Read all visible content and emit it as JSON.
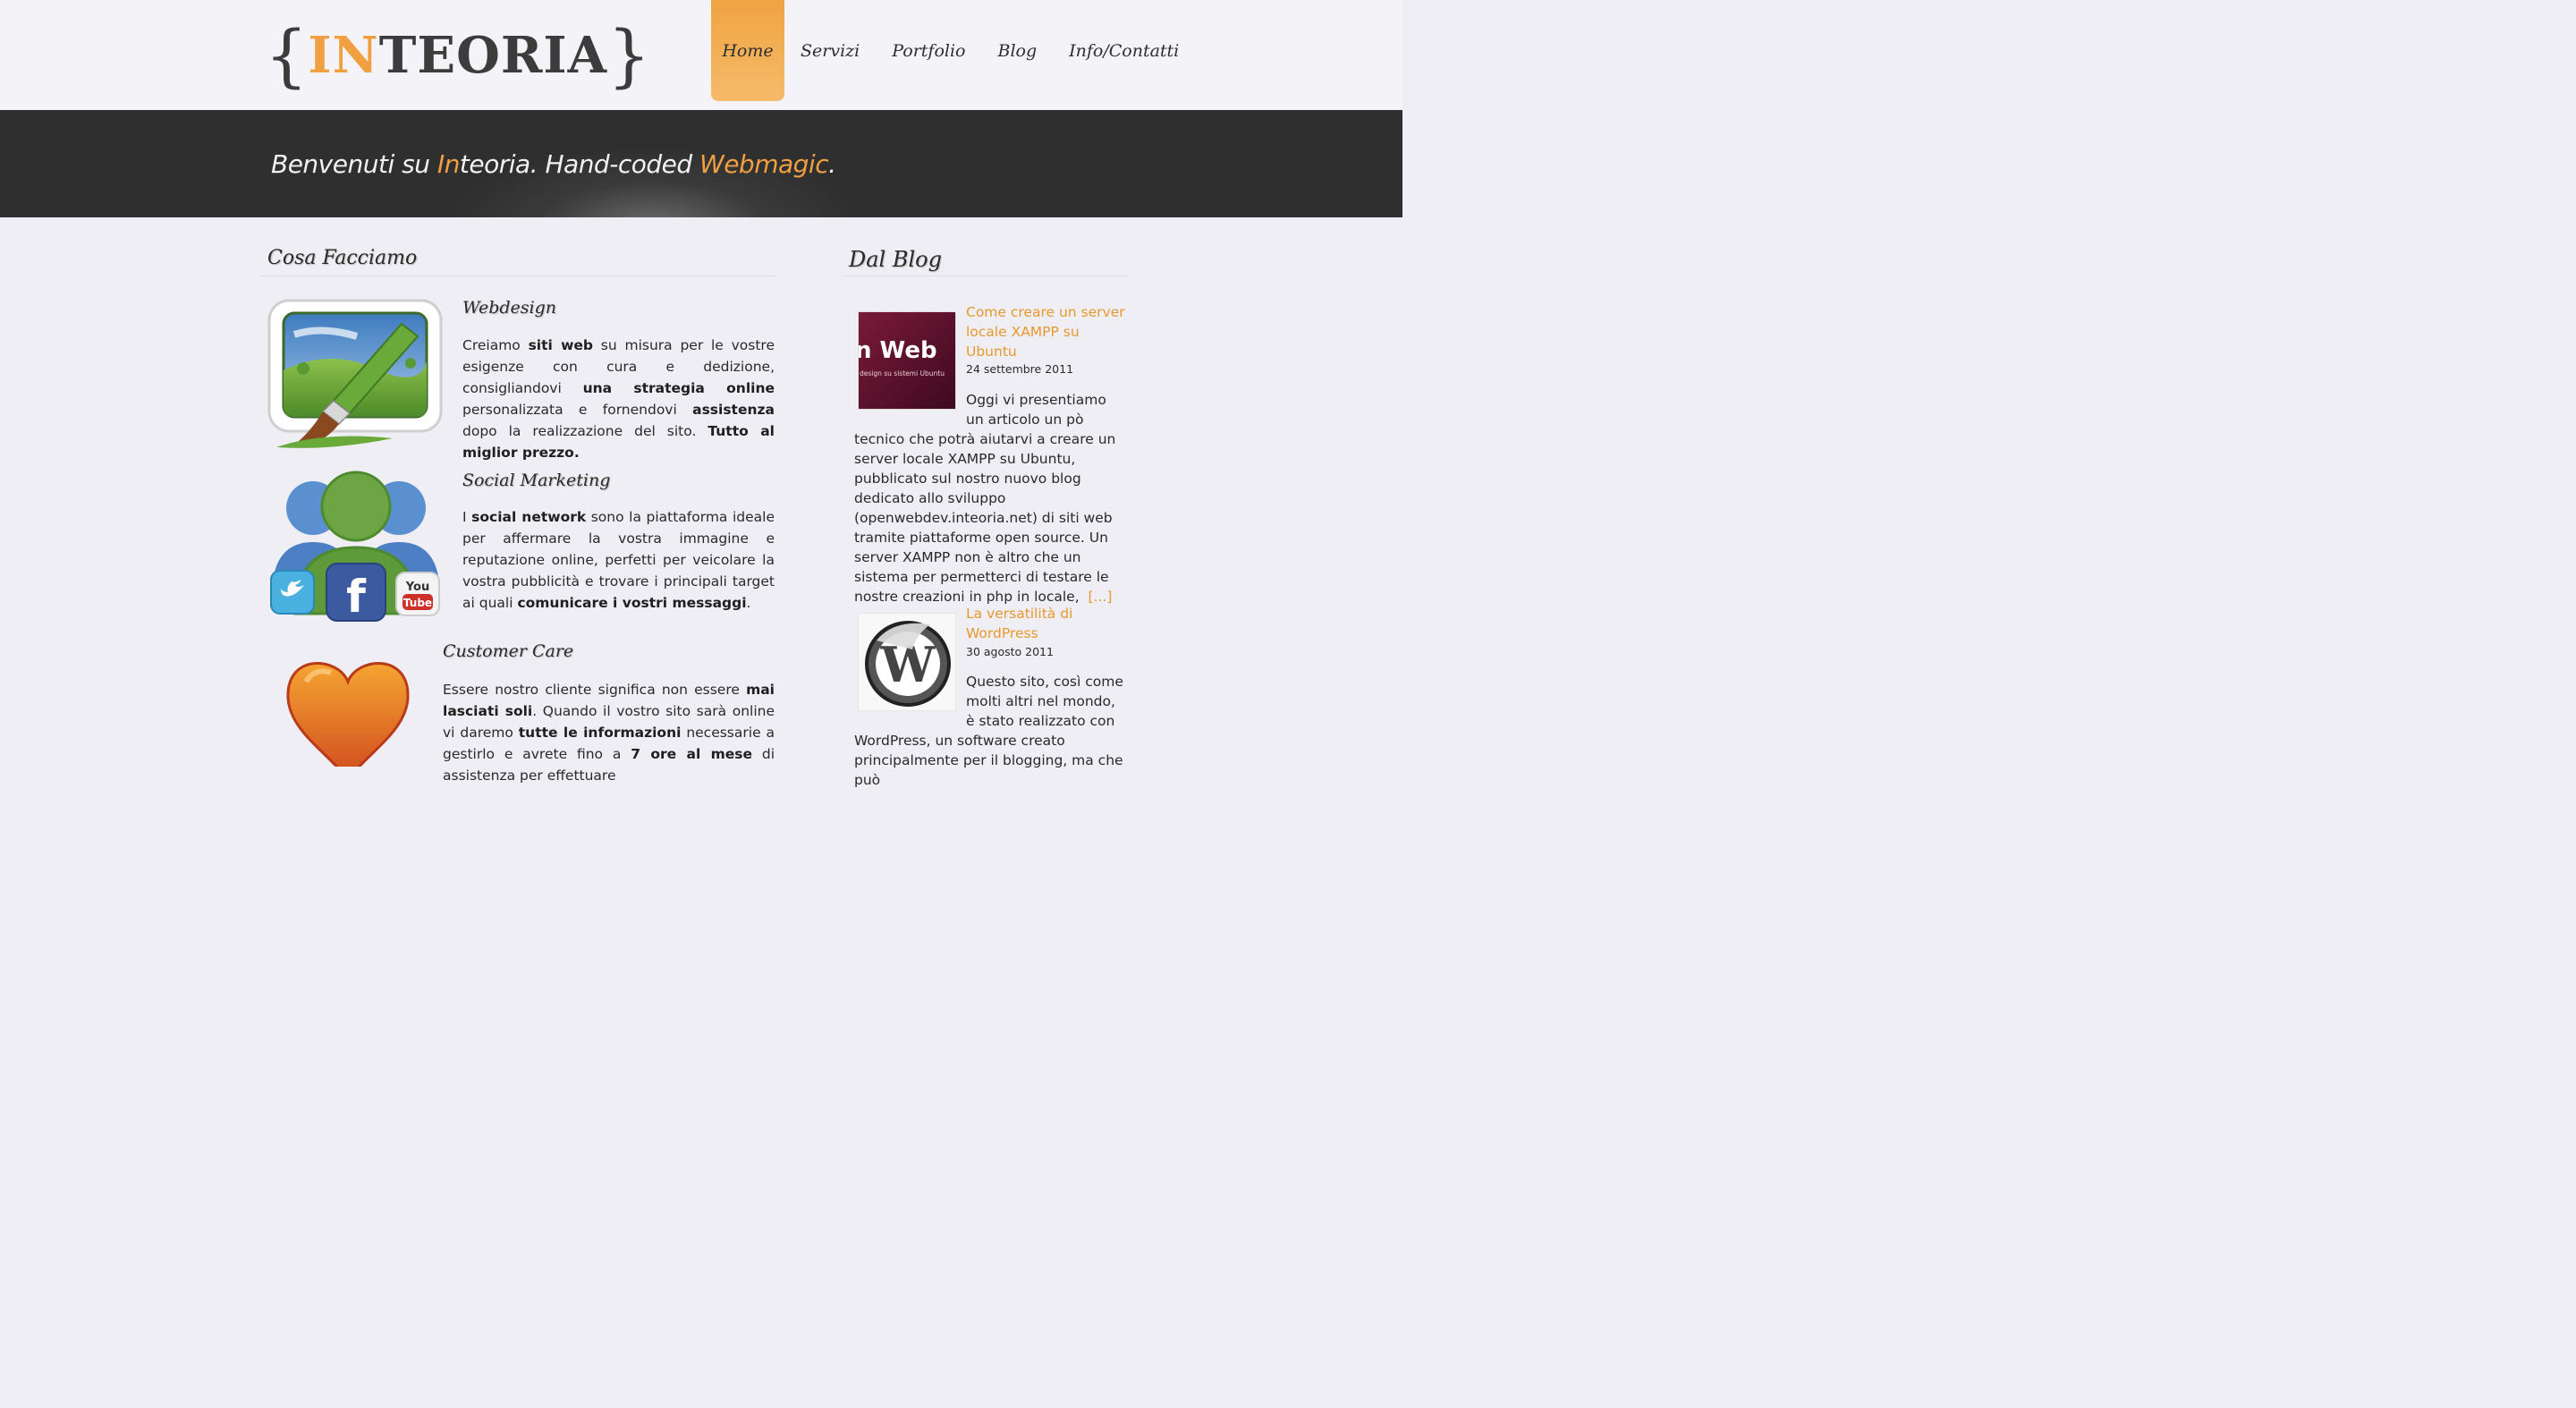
{
  "logo": {
    "brace_open": "{",
    "in": "IN",
    "rest": "TEORIA",
    "brace_close": "}"
  },
  "nav": [
    {
      "label": "Home",
      "active": true
    },
    {
      "label": "Servizi",
      "active": false
    },
    {
      "label": "Portfolio",
      "active": false
    },
    {
      "label": "Blog",
      "active": false
    },
    {
      "label": "Info/Contatti",
      "active": false
    }
  ],
  "banner": {
    "part1": "Benvenuti su ",
    "in": "In",
    "part2": "teoria. Hand-coded ",
    "magic": "Webmagic",
    "dot": "."
  },
  "services": {
    "title": "Cosa Facciamo",
    "items": [
      {
        "title": "Webdesign",
        "text_parts": [
          "Creiamo ",
          "siti web",
          " su misura per le vostre esigenze con cura e dedizione, consigliandovi ",
          "una strategia online",
          " personalizzata e fornendovi ",
          "assistenza",
          " dopo la realizzazione del sito. ",
          "Tutto al miglior prezzo."
        ]
      },
      {
        "title": "Social Marketing",
        "text_parts": [
          "I ",
          "social network",
          " sono la piattaforma ideale per affermare la vostra immagine e reputazione online, perfetti per veicolare la vostra pubblicità e trovare i principali target ai quali ",
          "comunicare i vostri messaggi",
          "."
        ]
      },
      {
        "title": "Customer Care",
        "text_parts": [
          "Essere nostro cliente significa non essere ",
          "mai lasciati soli",
          ". Quando il vostro sito sarà online vi daremo ",
          "tutte le informazioni",
          " necessarie a gestirlo e avrete fino a ",
          "7 ore al mese",
          " di assistenza per effettuare"
        ]
      }
    ]
  },
  "blog": {
    "title": "Dal Blog",
    "posts": [
      {
        "thumb_text": "n Web",
        "thumb_subtext": "design su sistemi Ubuntu",
        "title": "Come creare un server locale XAMPP su Ubuntu",
        "date": "24 settembre 2011",
        "excerpt": "Oggi vi presentiamo un articolo un pò tecnico che potrà aiutarvi a creare un server locale XAMPP su Ubuntu, pubblicato sul nostro nuovo blog dedicato allo sviluppo (openwebdev.inteoria.net) di siti web tramite piattaforme open source. Un server XAMPP non è altro che un sistema per permetterci di testare le nostre creazioni in php in locale,",
        "more": "[...]"
      },
      {
        "title": "La versatilità di WordPress",
        "date": "30 agosto 2011",
        "excerpt": "Questo sito, così come molti altri nel mondo, è stato realizzato con WordPress, un software creato principalmente per il blogging, ma che può"
      }
    ]
  },
  "colors": {
    "accent": "#f0a040",
    "banner": "#2f2f2f",
    "background": "#eeeef4"
  }
}
